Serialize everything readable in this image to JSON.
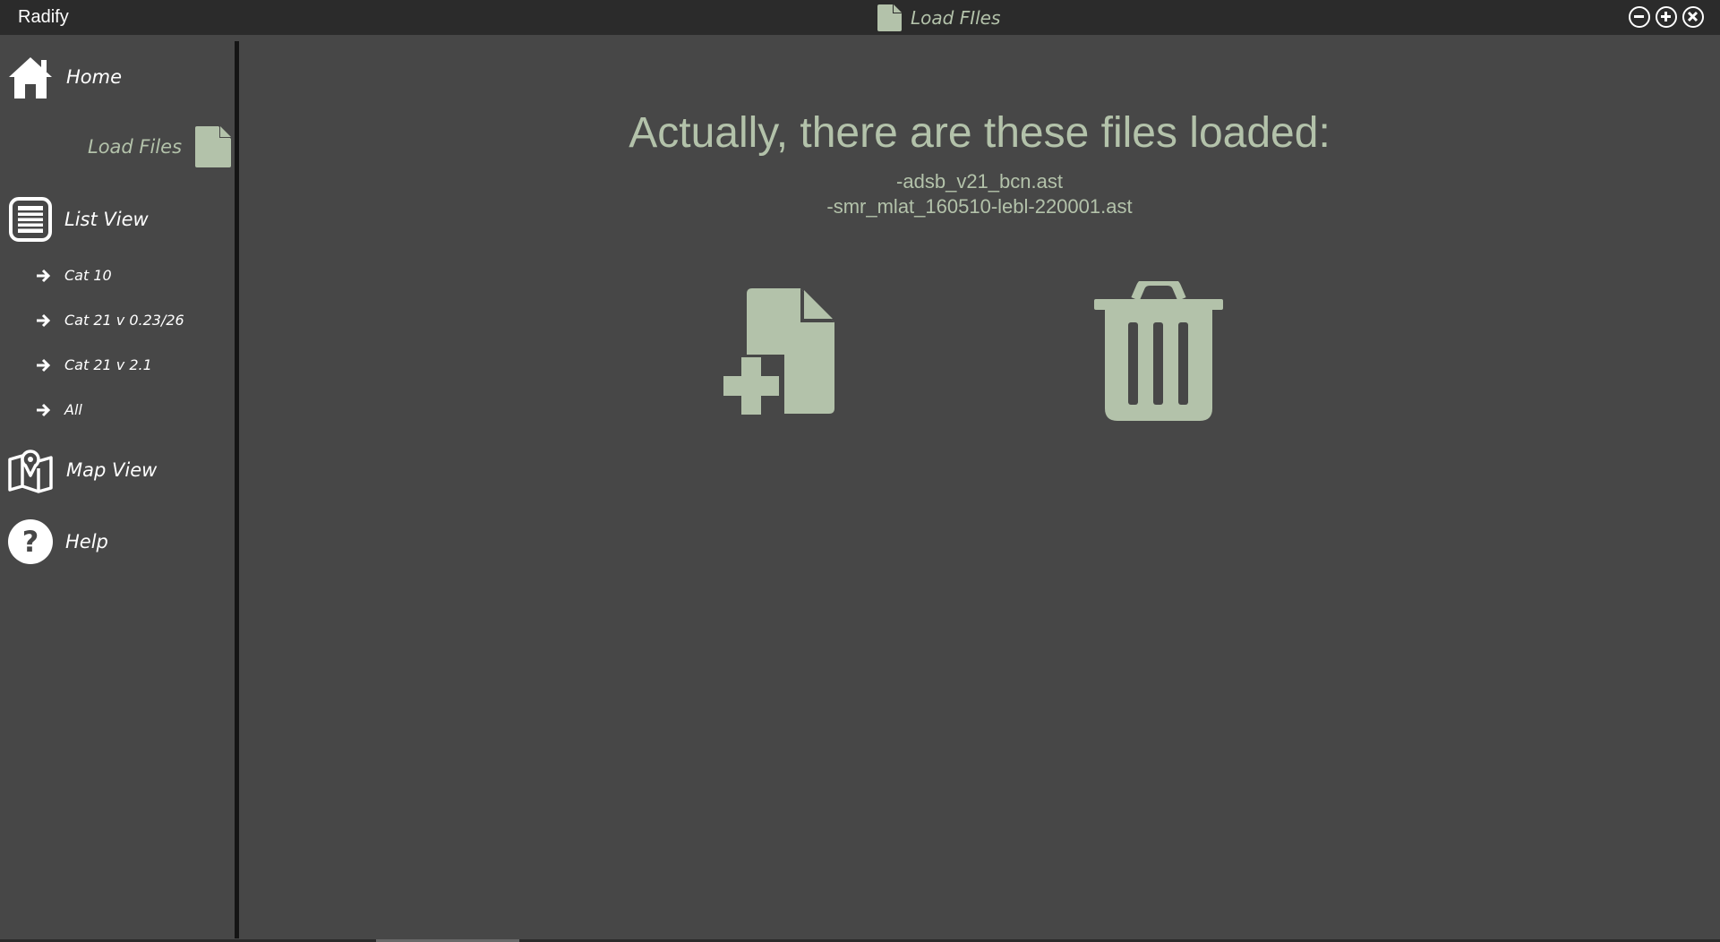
{
  "app": {
    "title": "Radify",
    "window_title": "Load FIles",
    "window_title_icon": "document-icon"
  },
  "window_controls": {
    "minimize_icon": "minimize-icon",
    "maximize_icon": "maximize-icon",
    "close_icon": "close-icon"
  },
  "sidebar": {
    "home": {
      "label": "Home",
      "icon": "home-icon"
    },
    "load_files": {
      "label": "Load Files",
      "icon": "document-icon",
      "active": true
    },
    "list_view": {
      "label": "List View",
      "icon": "list-icon"
    },
    "sub_items": [
      {
        "label": "Cat 10",
        "icon": "arrow-right-icon"
      },
      {
        "label": "Cat 21 v 0.23/26",
        "icon": "arrow-right-icon"
      },
      {
        "label": "Cat 21 v 2.1",
        "icon": "arrow-right-icon"
      },
      {
        "label": "All",
        "icon": "arrow-right-icon"
      }
    ],
    "map_view": {
      "label": "Map View",
      "icon": "map-pin-icon"
    },
    "help": {
      "label": "Help",
      "icon": "help-icon"
    }
  },
  "main": {
    "heading": "Actually, there are these files loaded:",
    "files": [
      "-adsb_v21_bcn.ast",
      "-smr_mlat_160510-lebl-220001.ast"
    ],
    "add_file_icon": "add-file-icon",
    "delete_icon": "trash-icon"
  },
  "colors": {
    "background": "#474747",
    "titlebar": "#2b2b2b",
    "accent": "#b3c2aa",
    "divider": "#141414",
    "text": "#ffffff"
  }
}
